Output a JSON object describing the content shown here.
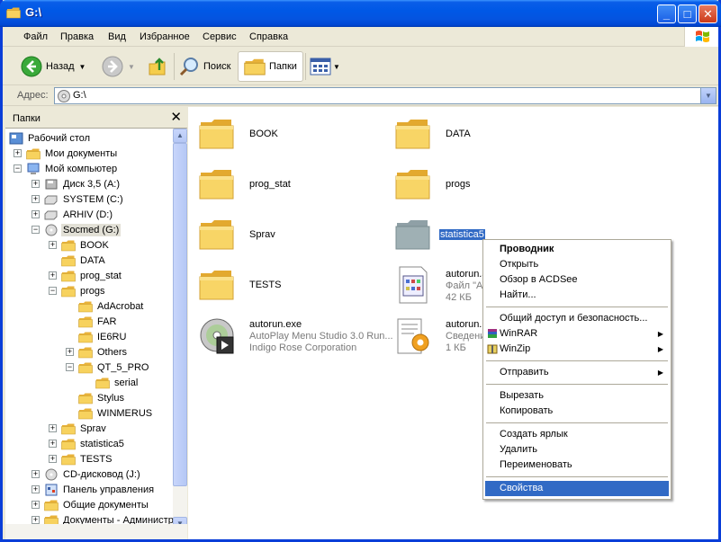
{
  "window": {
    "title": "G:\\"
  },
  "menu": [
    "Файл",
    "Правка",
    "Вид",
    "Избранное",
    "Сервис",
    "Справка"
  ],
  "toolbar": {
    "back": "Назад",
    "search": "Поиск",
    "folders": "Папки"
  },
  "address": {
    "label": "Адрес:",
    "value": "G:\\"
  },
  "folders_pane": {
    "title": "Папки",
    "tree": [
      {
        "label": "Рабочий стол"
      },
      {
        "label": "Мои документы"
      },
      {
        "label": "Мой компьютер"
      },
      {
        "label": "Диск 3,5 (A:)"
      },
      {
        "label": "SYSTEM (C:)"
      },
      {
        "label": "ARHIV (D:)"
      },
      {
        "label": "Socmed (G:)"
      },
      {
        "label": "BOOK"
      },
      {
        "label": "DATA"
      },
      {
        "label": "prog_stat"
      },
      {
        "label": "progs"
      },
      {
        "label": "AdAcrobat"
      },
      {
        "label": "FAR"
      },
      {
        "label": "IE6RU"
      },
      {
        "label": "Others"
      },
      {
        "label": "QT_5_PRO"
      },
      {
        "label": "serial"
      },
      {
        "label": "Stylus"
      },
      {
        "label": "WINMERUS"
      },
      {
        "label": "Sprav"
      },
      {
        "label": "statistica5"
      },
      {
        "label": "TESTS"
      },
      {
        "label": "CD-дисковод (J:)"
      },
      {
        "label": "Панель управления"
      },
      {
        "label": "Общие документы"
      },
      {
        "label": "Документы - Администр"
      }
    ]
  },
  "files": [
    {
      "name": "BOOK"
    },
    {
      "name": "DATA"
    },
    {
      "name": "prog_stat"
    },
    {
      "name": "progs"
    },
    {
      "name": "Sprav"
    },
    {
      "name": "statistica5"
    },
    {
      "name": "TESTS"
    },
    {
      "name": "autorun.a",
      "meta1": "Файл \"AP",
      "meta2": "42 КБ"
    },
    {
      "name": "autorun.exe",
      "meta1": "AutoPlay Menu Studio 3.0 Run...",
      "meta2": "Indigo Rose Corporation"
    },
    {
      "name": "autorun.in",
      "meta1": "Сведени",
      "meta2": "1 КБ"
    }
  ],
  "context_menu": [
    {
      "label": "Проводник"
    },
    {
      "label": "Открыть"
    },
    {
      "label": "Обзор в ACDSee"
    },
    {
      "label": "Найти..."
    },
    {
      "label": "Общий доступ и безопасность..."
    },
    {
      "label": "WinRAR"
    },
    {
      "label": "WinZip"
    },
    {
      "label": "Отправить"
    },
    {
      "label": "Вырезать"
    },
    {
      "label": "Копировать"
    },
    {
      "label": "Создать ярлык"
    },
    {
      "label": "Удалить"
    },
    {
      "label": "Переименовать"
    },
    {
      "label": "Свойства"
    }
  ],
  "colors": {
    "selection": "#316ac5",
    "titlebar": "#0058e6",
    "folder": "#f5cd4c"
  }
}
